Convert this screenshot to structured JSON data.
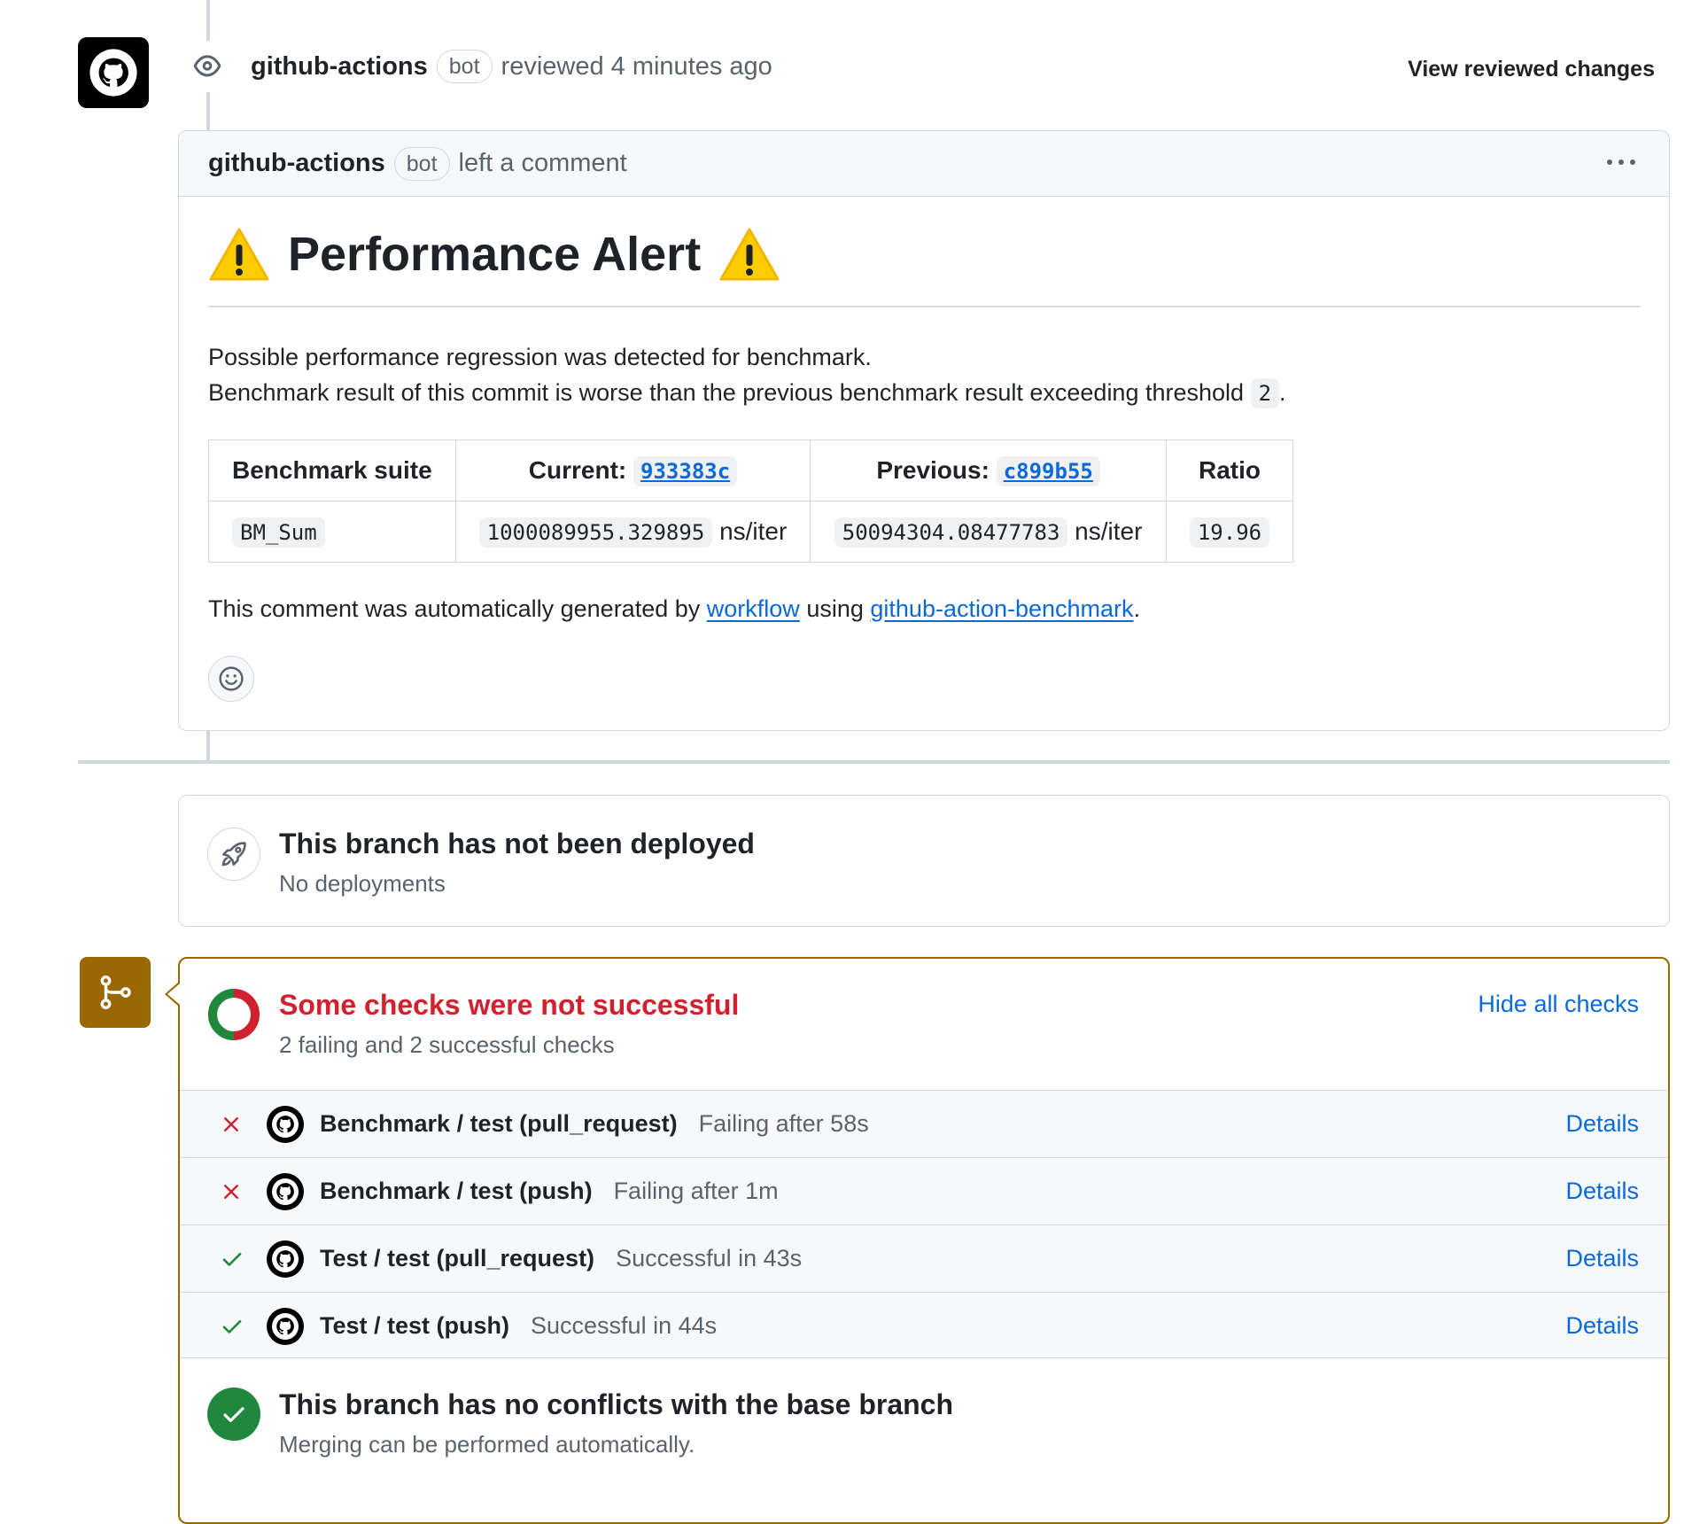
{
  "review": {
    "author": "github-actions",
    "badge": "bot",
    "action": "reviewed 4 minutes ago",
    "view_changes": "View reviewed changes"
  },
  "comment": {
    "author": "github-actions",
    "badge": "bot",
    "action": "left a comment",
    "title": "Performance Alert",
    "line1": "Possible performance regression was detected for benchmark.",
    "line2": "Benchmark result of this commit is worse than the previous benchmark result exceeding threshold",
    "threshold": "2",
    "line2_end": ".",
    "table": {
      "headers": {
        "suite": "Benchmark suite",
        "current_label": "Current:",
        "current_sha": "933383c",
        "previous_label": "Previous:",
        "previous_sha": "c899b55",
        "ratio": "Ratio"
      },
      "rows": [
        {
          "suite": "BM_Sum",
          "current": "1000089955.329895",
          "current_unit": "ns/iter",
          "previous": "50094304.08477783",
          "previous_unit": "ns/iter",
          "ratio": "19.96"
        }
      ]
    },
    "footer_pre": "This comment was automatically generated by",
    "footer_link1": "workflow",
    "footer_mid": "using",
    "footer_link2": "github-action-benchmark",
    "footer_end": "."
  },
  "deploy": {
    "title": "This branch has not been deployed",
    "subtitle": "No deployments"
  },
  "checks": {
    "title": "Some checks were not successful",
    "subtitle": "2 failing and 2 successful checks",
    "hide_label": "Hide all checks",
    "title_color": "#cf222e",
    "items": [
      {
        "status": "fail",
        "name": "Benchmark / test (pull_request)",
        "desc": "Failing after 58s",
        "details": "Details"
      },
      {
        "status": "fail",
        "name": "Benchmark / test (push)",
        "desc": "Failing after 1m",
        "details": "Details"
      },
      {
        "status": "pass",
        "name": "Test / test (pull_request)",
        "desc": "Successful in 43s",
        "details": "Details"
      },
      {
        "status": "pass",
        "name": "Test / test (push)",
        "desc": "Successful in 44s",
        "details": "Details"
      }
    ]
  },
  "merge": {
    "title": "This branch has no conflicts with the base branch",
    "subtitle": "Merging can be performed automatically."
  },
  "colors": {
    "accent": "#0969da",
    "fail": "#cf222e",
    "success": "#1f883d",
    "warning_border": "#9a6700"
  },
  "icons": {
    "avatar": "github-octocat-icon",
    "eye": "eye-icon",
    "kebab": "kebab-horizontal-icon",
    "warning": "warning-emoji-icon",
    "smiley": "smiley-icon",
    "rocket": "rocket-icon",
    "merge": "git-branch-icon",
    "fail": "x-icon",
    "pass": "check-icon"
  }
}
